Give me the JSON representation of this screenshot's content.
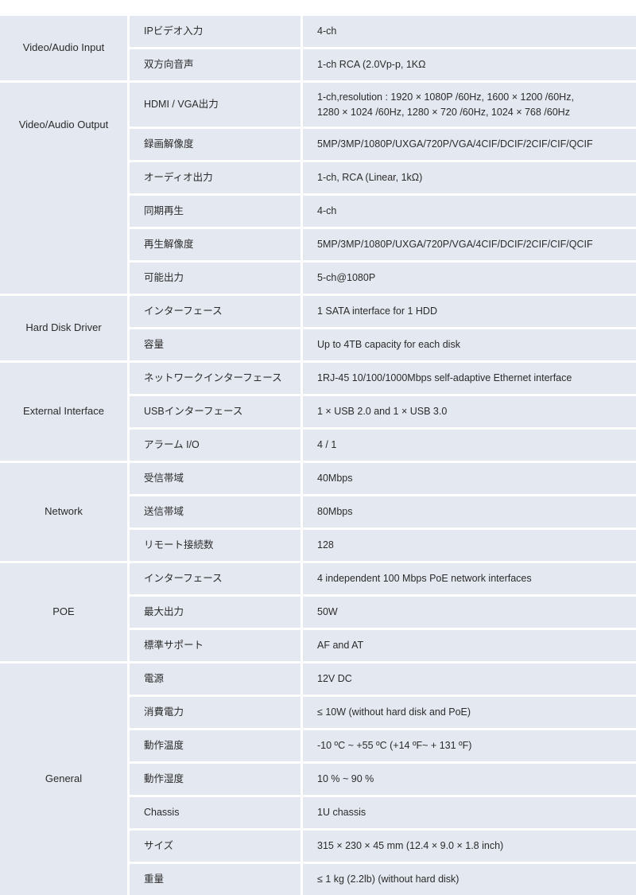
{
  "theme": {
    "cell_background": "#e4e8f0",
    "page_background": "#ffffff",
    "text_color": "#2b2b2b",
    "separator_color": "#ffffff"
  },
  "table": {
    "columns": 3,
    "groups": [
      {
        "label": "Video/Audio Input",
        "label_align": "center",
        "rows": [
          {
            "key": "IPビデオ入力",
            "value": "4-ch",
            "tall": false
          },
          {
            "key": "双方向音声",
            "value": "1-ch RCA (2.0Vp-p, 1KΩ",
            "tall": false
          }
        ]
      },
      {
        "label": "Video/Audio Output",
        "label_align": "high",
        "rows": [
          {
            "key": "HDMI / VGA出力",
            "value": "1-ch,resolution : 1920 × 1080P /60Hz, 1600 × 1200 /60Hz,\n1280 × 1024 /60Hz, 1280 × 720 /60Hz, 1024 × 768 /60Hz",
            "tall": true
          },
          {
            "key": "録画解像度",
            "value": "5MP/3MP/1080P/UXGA/720P/VGA/4CIF/DCIF/2CIF/CIF/QCIF",
            "tall": false
          },
          {
            "key": "オーディオ出力",
            "value": "1-ch, RCA (Linear, 1kΩ)",
            "tall": false
          },
          {
            "key": "同期再生",
            "value": "4-ch",
            "tall": false
          },
          {
            "key": "再生解像度",
            "value": "5MP/3MP/1080P/UXGA/720P/VGA/4CIF/DCIF/2CIF/CIF/QCIF",
            "tall": false
          },
          {
            "key": "可能出力",
            "value": "5-ch@1080P",
            "tall": false
          }
        ]
      },
      {
        "label": "Hard Disk Driver",
        "label_align": "center",
        "rows": [
          {
            "key": "インターフェース",
            "value": "1 SATA interface for 1 HDD",
            "tall": false
          },
          {
            "key": "容量",
            "value": "Up to 4TB capacity for each disk",
            "tall": false
          }
        ]
      },
      {
        "label": "External Interface",
        "label_align": "center",
        "rows": [
          {
            "key": "ネットワークインターフェース",
            "value": "1RJ-45 10/100/1000Mbps self-adaptive Ethernet interface",
            "tall": false
          },
          {
            "key": "USBインターフェース",
            "value": "1 × USB 2.0 and 1 × USB 3.0",
            "tall": false
          },
          {
            "key": "アラーム I/O",
            "value": "4 / 1",
            "tall": false
          }
        ]
      },
      {
        "label": "Network",
        "label_align": "center",
        "rows": [
          {
            "key": "受信帯域",
            "value": "40Mbps",
            "tall": false
          },
          {
            "key": "送信帯域",
            "value": "80Mbps",
            "tall": false
          },
          {
            "key": "リモート接続数",
            "value": "128",
            "tall": false
          }
        ]
      },
      {
        "label": "POE",
        "label_align": "center",
        "rows": [
          {
            "key": "インターフェース",
            "value": "4 independent 100 Mbps PoE network interfaces",
            "tall": false
          },
          {
            "key": "最大出力",
            "value": "50W",
            "tall": false
          },
          {
            "key": "標準サポート",
            "value": "AF and AT",
            "tall": false
          }
        ]
      },
      {
        "label": "General",
        "label_align": "center",
        "rows": [
          {
            "key": "電源",
            "value": "12V DC",
            "tall": false
          },
          {
            "key": "消費電力",
            "value": "≤ 10W (without hard disk and PoE)",
            "tall": false
          },
          {
            "key": "動作温度",
            "value": "-10 ºC ~ +55 ºC (+14 ºF~ + 131 ºF)",
            "tall": false
          },
          {
            "key": "動作湿度",
            "value": "10 % ~ 90 %",
            "tall": false
          },
          {
            "key": "Chassis",
            "value": "1U chassis",
            "tall": false
          },
          {
            "key": "サイズ",
            "value": "315 × 230 × 45 mm (12.4 × 9.0 × 1.8 inch)",
            "tall": false
          },
          {
            "key": "重量",
            "value": "≤ 1 kg (2.2lb) (without hard disk)",
            "tall": false
          }
        ]
      }
    ]
  }
}
